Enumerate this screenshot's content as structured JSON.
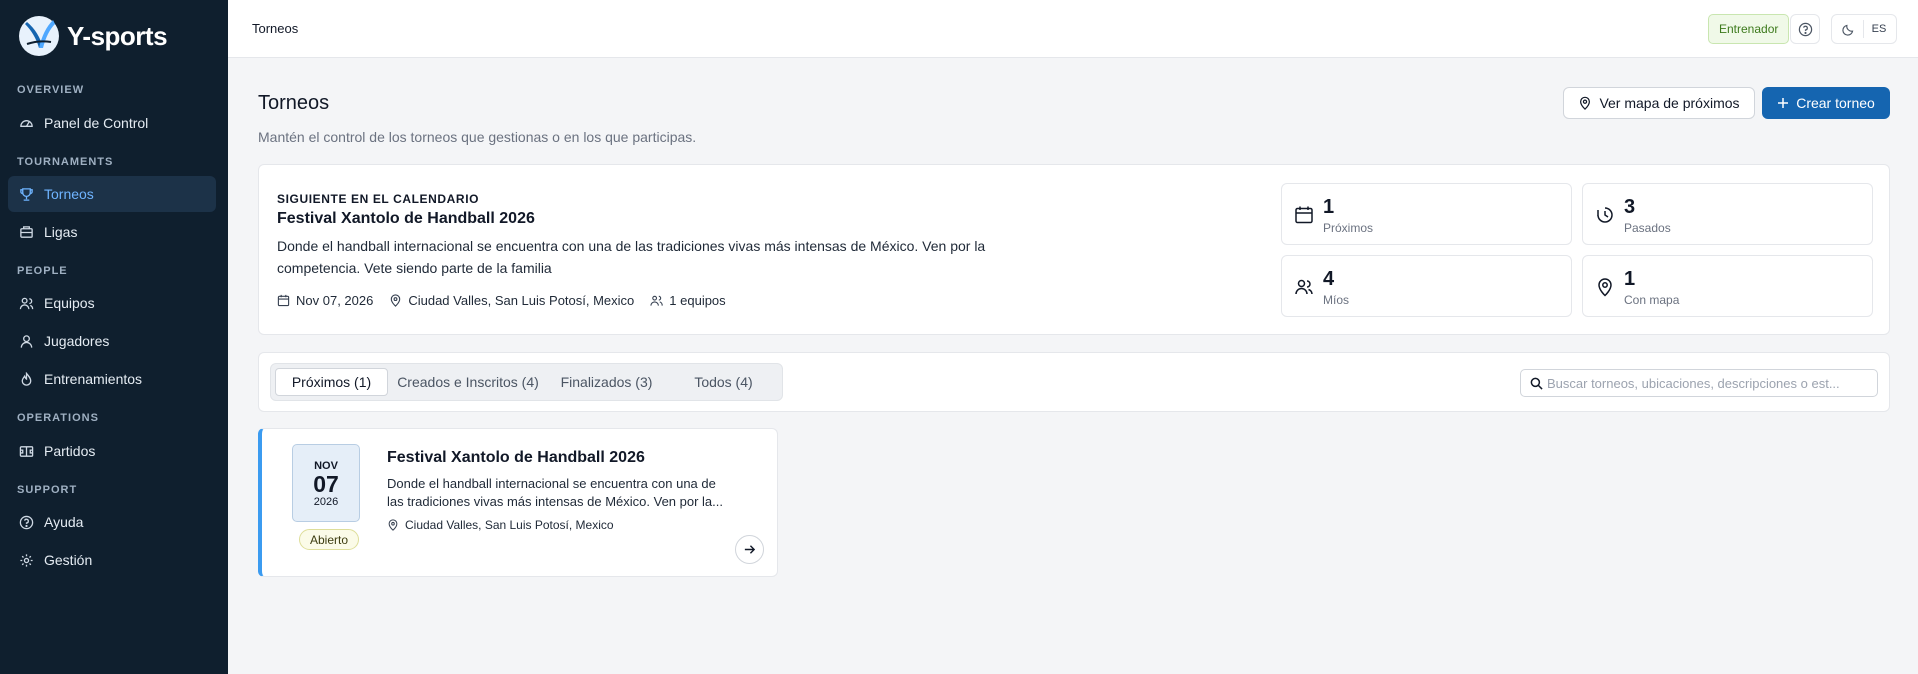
{
  "app": {
    "brand": "Y-sports"
  },
  "colors": {
    "sidebar_bg": "#0f1f2e",
    "accent": "#1565b0",
    "active_nav": "#6fb4ff",
    "card_accent": "#3b9bf0"
  },
  "sidebar": {
    "sections": [
      {
        "title": "OVERVIEW",
        "items": [
          {
            "label": "Panel de Control",
            "icon": "dashboard-icon"
          }
        ]
      },
      {
        "title": "TOURNAMENTS",
        "items": [
          {
            "label": "Torneos",
            "icon": "trophy-icon",
            "active": true
          },
          {
            "label": "Ligas",
            "icon": "league-icon"
          }
        ]
      },
      {
        "title": "PEOPLE",
        "items": [
          {
            "label": "Equipos",
            "icon": "team-icon"
          },
          {
            "label": "Jugadores",
            "icon": "user-icon"
          },
          {
            "label": "Entrenamientos",
            "icon": "training-icon"
          }
        ]
      },
      {
        "title": "OPERATIONS",
        "items": [
          {
            "label": "Partidos",
            "icon": "matches-icon"
          }
        ]
      },
      {
        "title": "SUPPORT",
        "items": [
          {
            "label": "Ayuda",
            "icon": "help-icon"
          },
          {
            "label": "Gestión",
            "icon": "gear-icon"
          }
        ]
      }
    ]
  },
  "topbar": {
    "breadcrumb": "Torneos",
    "role": "Entrenador",
    "language": "ES"
  },
  "header": {
    "title": "Torneos",
    "subtitle": "Mantén el control de los torneos que gestionas o en los que participas.",
    "map_button": "Ver mapa de próximos",
    "create_button": "Crear torneo"
  },
  "next_event": {
    "kicker": "SIGUIENTE EN EL CALENDARIO",
    "title": "Festival Xantolo de Handball 2026",
    "description": "Donde el handball internacional se encuentra con una de las tradiciones vivas más intensas de México. Ven por la competencia. Vete siendo parte de la familia",
    "date": "Nov 07, 2026",
    "location": "Ciudad Valles, San Luis Potosí, Mexico",
    "teams": "1 equipos"
  },
  "stats": [
    {
      "value": "1",
      "label": "Próximos",
      "icon": "calendar-icon"
    },
    {
      "value": "3",
      "label": "Pasados",
      "icon": "history-icon"
    },
    {
      "value": "4",
      "label": "Míos",
      "icon": "people-icon"
    },
    {
      "value": "1",
      "label": "Con mapa",
      "icon": "map-pin-icon"
    }
  ],
  "tabs": [
    {
      "label": "Próximos (1)",
      "active": true
    },
    {
      "label": "Creados e Inscritos (4)"
    },
    {
      "label": "Finalizados (3)"
    },
    {
      "label": "Todos (4)"
    }
  ],
  "search": {
    "placeholder": "Buscar torneos, ubicaciones, descripciones o est...",
    "value": ""
  },
  "tournaments": [
    {
      "month": "NOV",
      "day": "07",
      "year": "2026",
      "status": "Abierto",
      "title": "Festival Xantolo de Handball 2026",
      "description": "Donde el handball internacional se encuentra con una de las tradiciones vivas más intensas de México. Ven por la...",
      "location": "Ciudad Valles, San Luis Potosí, Mexico"
    }
  ]
}
